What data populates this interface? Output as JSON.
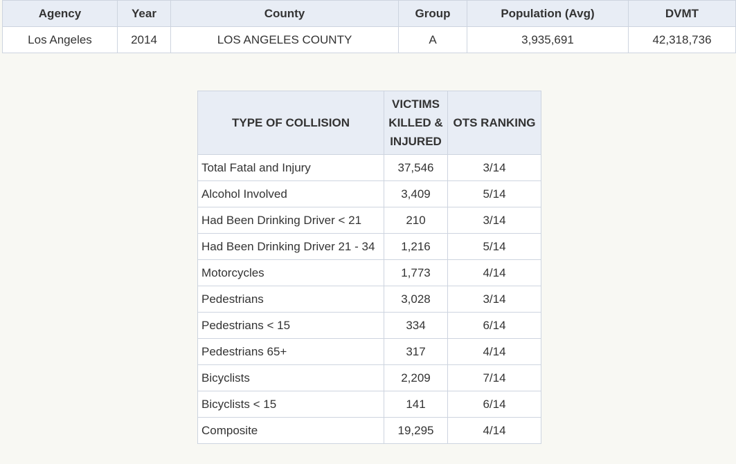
{
  "summary": {
    "headers": [
      "Agency",
      "Year",
      "County",
      "Group",
      "Population (Avg)",
      "DVMT"
    ],
    "row": [
      "Los Angeles",
      "2014",
      "LOS ANGELES COUNTY",
      "A",
      "3,935,691",
      "42,318,736"
    ]
  },
  "collision_table": {
    "headers": {
      "type": "TYPE OF COLLISION",
      "victims": "VICTIMS KILLED & INJURED",
      "ranking": "OTS RANKING"
    },
    "rows": [
      {
        "type": "Total Fatal and Injury",
        "victims": "37,546",
        "ranking": "3/14"
      },
      {
        "type": "Alcohol Involved",
        "victims": "3,409",
        "ranking": "5/14"
      },
      {
        "type": "Had Been Drinking Driver < 21",
        "victims": "210",
        "ranking": "3/14"
      },
      {
        "type": "Had Been Drinking Driver 21 - 34",
        "victims": "1,216",
        "ranking": "5/14"
      },
      {
        "type": "Motorcycles",
        "victims": "1,773",
        "ranking": "4/14"
      },
      {
        "type": "Pedestrians",
        "victims": "3,028",
        "ranking": "3/14"
      },
      {
        "type": "Pedestrians < 15",
        "victims": "334",
        "ranking": "6/14"
      },
      {
        "type": "Pedestrians 65+",
        "victims": "317",
        "ranking": "4/14"
      },
      {
        "type": "Bicyclists",
        "victims": "2,209",
        "ranking": "7/14"
      },
      {
        "type": "Bicyclists < 15",
        "victims": "141",
        "ranking": "6/14"
      },
      {
        "type": "Composite",
        "victims": "19,295",
        "ranking": "4/14"
      }
    ]
  }
}
